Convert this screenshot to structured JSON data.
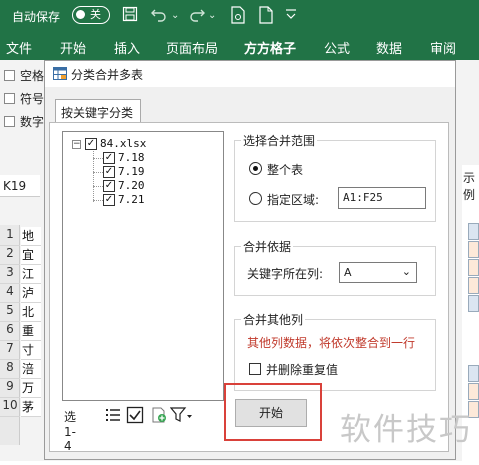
{
  "titlebar": {
    "autosave_label": "自动保存",
    "toggle_label": "关"
  },
  "ribbon": {
    "tabs": [
      "文件",
      "开始",
      "插入",
      "页面布局",
      "方方格子",
      "公式",
      "数据",
      "审阅"
    ]
  },
  "background": {
    "checks": [
      "空格",
      "符号",
      "数字"
    ],
    "namebox": "K19",
    "rows": [
      "1",
      "2",
      "3",
      "4",
      "5",
      "6",
      "7",
      "8",
      "9",
      "10"
    ],
    "cells": [
      "地",
      "宜",
      "江",
      "泸",
      "北",
      "重",
      "寸",
      "涪",
      "万",
      "茅"
    ],
    "right_label": "示例"
  },
  "dialog": {
    "title": "分类合并多表",
    "tab": "按关键字分类",
    "tree": {
      "root": "84.xlsx",
      "children": [
        "7.18",
        "7.19",
        "7.20",
        "7.21"
      ]
    },
    "treebar_label": "选1-4",
    "range_group": {
      "title": "选择合并范围",
      "option_whole": "整个表",
      "option_region": "指定区域:",
      "region_value": "A1:F25"
    },
    "basis_group": {
      "title": "合并依据",
      "key_col_label": "关键字所在列:",
      "key_col_value": "A"
    },
    "other_group": {
      "title": "合并其他列",
      "note": "其他列数据，将依次整合到一行",
      "dedupe_label": "并删除重复值"
    },
    "start_button": "开始"
  },
  "watermark": "软件技巧",
  "colors": {
    "excel_green": "#217346",
    "highlight_red": "#d9413a",
    "note_red": "#c0392b"
  }
}
